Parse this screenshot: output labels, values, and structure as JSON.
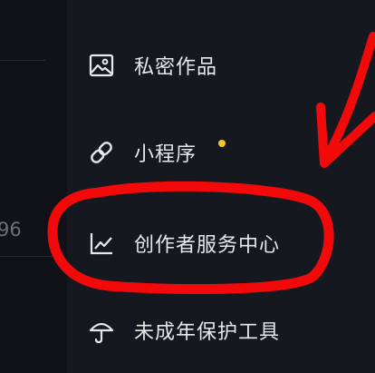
{
  "background": {
    "partial_number": "96"
  },
  "menu": {
    "items": [
      {
        "label": "私密作品",
        "icon": "image-icon"
      },
      {
        "label": "小程序",
        "icon": "link-icon",
        "has_dot": true
      },
      {
        "label": "创作者服务中心",
        "icon": "chart-icon"
      },
      {
        "label": "未成年保护工具",
        "icon": "umbrella-icon"
      }
    ]
  },
  "colors": {
    "text": "#e8e8ea",
    "dot": "#f5c72a",
    "annotation": "#f20a0a",
    "background": "#16181f"
  }
}
